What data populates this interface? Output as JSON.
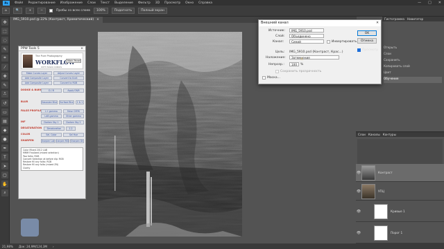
{
  "app": {
    "logo": "Ps",
    "menu": [
      "Файл",
      "Редактирование",
      "Изображение",
      "Слои",
      "Текст",
      "Выделение",
      "Фильтр",
      "3D",
      "Просмотр",
      "Окно",
      "Справка"
    ],
    "window_controls": [
      "—",
      "□",
      "✕"
    ]
  },
  "options_bar": {
    "sample_all_label": "Пробы со всех слоев",
    "zoom_value": "100%",
    "fit_screen_label": "Подогнать",
    "full_screen_label": "Полный экран"
  },
  "document": {
    "tab_title": "IMG_5910.psd @ 22% (Контраст, Хроматический)",
    "tab_close": "×"
  },
  "ppw_panel": {
    "title": "PPW Tools 5",
    "close": "×",
    "banner_top": "The Pure Photography",
    "banner_brand": "WORKFLOW",
    "banner_sub": "WITH MARK DUBOIS",
    "mode_select": "Main Panel",
    "buttons_top": [
      "Make Curves Layer",
      "Adjust Curves Layer",
      "Add Composite Layer",
      "Convert to 8-bit",
      "Add Composite Layer",
      "Convert to RGB"
    ],
    "sections": [
      {
        "label": "DODGE & BURN",
        "buttons": [
          "D / B",
          "Apply D&B"
        ]
      },
      {
        "label": "BLUR",
        "buttons": [
          "Gaussian Blur",
          "Surface Blur",
          "1 & 1"
        ]
      },
      {
        "label": "FALSE PROFILE",
        "buttons": [
          "L+ gamma",
          "False CMYK",
          "LAB gamma",
          "Other gamma"
        ]
      },
      {
        "label": "INF",
        "buttons": [
          "Darken Sky 1",
          "Darken Sky 2"
        ]
      },
      {
        "label": "DESATURATION",
        "buttons": [
          "Desaturation",
          "Desaturation 1",
          "1.2"
        ]
      },
      {
        "label": "COLOR",
        "buttons": [
          "Sel. Color",
          "Sel Hue"
        ]
      },
      {
        "label": "SHARPEN",
        "buttons": [
          "Sharpen Lab",
          "Sharpen RGB",
          "Sharpen Dtl"
        ]
      }
    ],
    "log": [
      "Color Mixed 2012 LAB",
      "MMM Finalized (mixed selection)",
      "Two folks: RGB",
      "Convert Selection at before dip: RGB",
      "Restore fill any folks: RGB",
      "Restore fill any folks (mixed ZN)",
      "Clarity"
    ]
  },
  "dialog": {
    "title": "Внешний канал",
    "close": "✕",
    "source_label": "Источник:",
    "source_value": "IMG_5910.psd",
    "layer_label": "Слой:",
    "layer_value": "Объединено",
    "channel_label": "Канал:",
    "channel_value": "Синий",
    "invert_label": "Инвертировать",
    "target_label": "Цель:",
    "target_value": "IMG_5910.psd (Контраст, Крас...)",
    "blending_label": "Наложение:",
    "blending_value": "Затемнение",
    "opacity_label": "Непрозр.:",
    "opacity_value": "100",
    "opacity_unit": "%",
    "preserve_label": "Сохранить прозрачность",
    "mask_label": "Маска...",
    "ok_label": "OK",
    "cancel_label": "Отмена",
    "preview_label": "Просмотр"
  },
  "right_panel": {
    "tabs": [
      "Гистограмма",
      "Навигатор"
    ],
    "list": [
      "Открыть",
      "Слои",
      "Сохранить",
      "Копировать слой",
      "Цвет",
      "Обучение"
    ]
  },
  "layers_panel": {
    "tabs": [
      "Слои",
      "Каналы",
      "Контуры"
    ],
    "layers": [
      {
        "name": "Контраст",
        "eye": "👁"
      },
      {
        "name": "УПЦ",
        "eye": "👁"
      },
      {
        "name": "Кривые 1",
        "eye": "👁"
      },
      {
        "name": "Порог 1",
        "eye": "👁"
      }
    ]
  },
  "status": {
    "zoom": "21,98%",
    "doc": "Док: 24,9M/124,3M",
    "arrow": "›"
  },
  "toolbar": {
    "tools": [
      "move-icon",
      "marquee-icon",
      "lasso-icon",
      "quick-select-icon",
      "crop-icon",
      "eyedropper-icon",
      "healing-icon",
      "brush-icon",
      "stamp-icon",
      "history-brush-icon",
      "eraser-icon",
      "gradient-icon",
      "blur-icon",
      "dodge-icon",
      "pen-icon",
      "type-icon",
      "path-select-icon",
      "shape-icon",
      "hand-icon",
      "zoom-icon"
    ]
  }
}
